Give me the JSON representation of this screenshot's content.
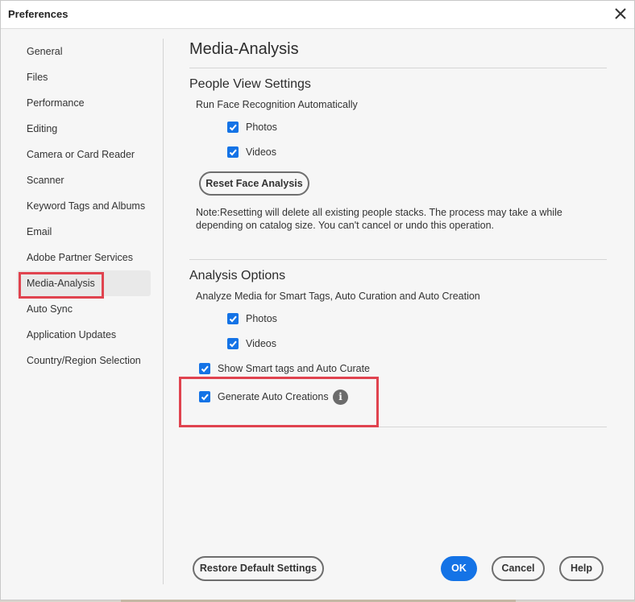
{
  "window": {
    "title": "Preferences"
  },
  "sidebar": {
    "items": [
      {
        "label": "General"
      },
      {
        "label": "Files"
      },
      {
        "label": "Performance"
      },
      {
        "label": "Editing"
      },
      {
        "label": "Camera or Card Reader"
      },
      {
        "label": "Scanner"
      },
      {
        "label": "Keyword Tags and Albums"
      },
      {
        "label": "Email"
      },
      {
        "label": "Adobe Partner Services"
      },
      {
        "label": "Media-Analysis",
        "selected": true
      },
      {
        "label": "Auto Sync"
      },
      {
        "label": "Application Updates"
      },
      {
        "label": "Country/Region Selection"
      }
    ]
  },
  "main": {
    "title": "Media-Analysis",
    "people_view": {
      "heading": "People View Settings",
      "subheading": "Run Face Recognition Automatically",
      "photos_label": "Photos",
      "photos_checked": true,
      "videos_label": "Videos",
      "videos_checked": true,
      "reset_button": "Reset Face Analysis",
      "note": "Note:Resetting will delete all existing people stacks. The process may take a while depending on catalog size. You can't cancel or undo this operation."
    },
    "analysis_options": {
      "heading": "Analysis Options",
      "subheading": "Analyze Media for Smart Tags, Auto Curation and Auto Creation",
      "photos_label": "Photos",
      "photos_checked": true,
      "videos_label": "Videos",
      "videos_checked": true,
      "smart_tags_label": "Show Smart tags and Auto Curate",
      "smart_tags_checked": true,
      "auto_creations_label": "Generate Auto Creations",
      "auto_creations_checked": true,
      "info_glyph": "i"
    }
  },
  "footer": {
    "restore_label": "Restore Default Settings",
    "ok_label": "OK",
    "cancel_label": "Cancel",
    "help_label": "Help"
  },
  "colors": {
    "accent": "#1473e6",
    "highlight": "#e0434f"
  },
  "icons": {
    "close": "close-icon",
    "info": "info-icon",
    "check": "checkmark-icon"
  }
}
